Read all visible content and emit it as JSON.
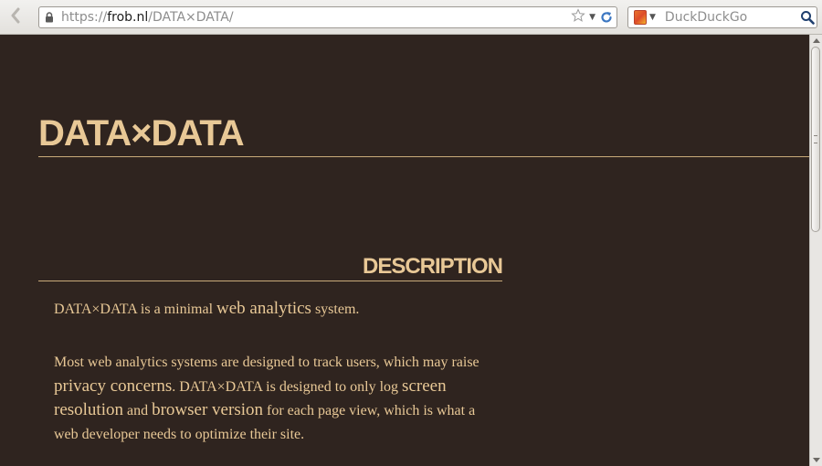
{
  "browser": {
    "url_prefix": "https://",
    "url_host": "frob.nl",
    "url_path": "/DATA×DATA/",
    "search_placeholder": "DuckDuckGo",
    "icons": {
      "back": "back-arrow-icon",
      "lock": "lock-icon",
      "bookmark": "star-icon",
      "reload": "reload-icon",
      "engine": "duckduckgo-icon",
      "search": "magnifier-icon"
    }
  },
  "page": {
    "title": "DATA×DATA",
    "section_heading": "DESCRIPTION",
    "p1": {
      "a": "DATA×DATA is a minimal ",
      "b": "web analytics",
      "c": " system."
    },
    "p2": {
      "a": "Most web analytics systems are designed to track users, which may raise ",
      "b": "privacy concerns",
      "c": ". DATA×DATA is designed to only log ",
      "d": "screen resolution",
      "e": " and ",
      "f": "browser version",
      "g": " for each page view, which is what a web developer needs to optimize their site."
    },
    "colors": {
      "background": "#2f241f",
      "text": "#e8c896",
      "rule": "#c9ab79"
    }
  }
}
